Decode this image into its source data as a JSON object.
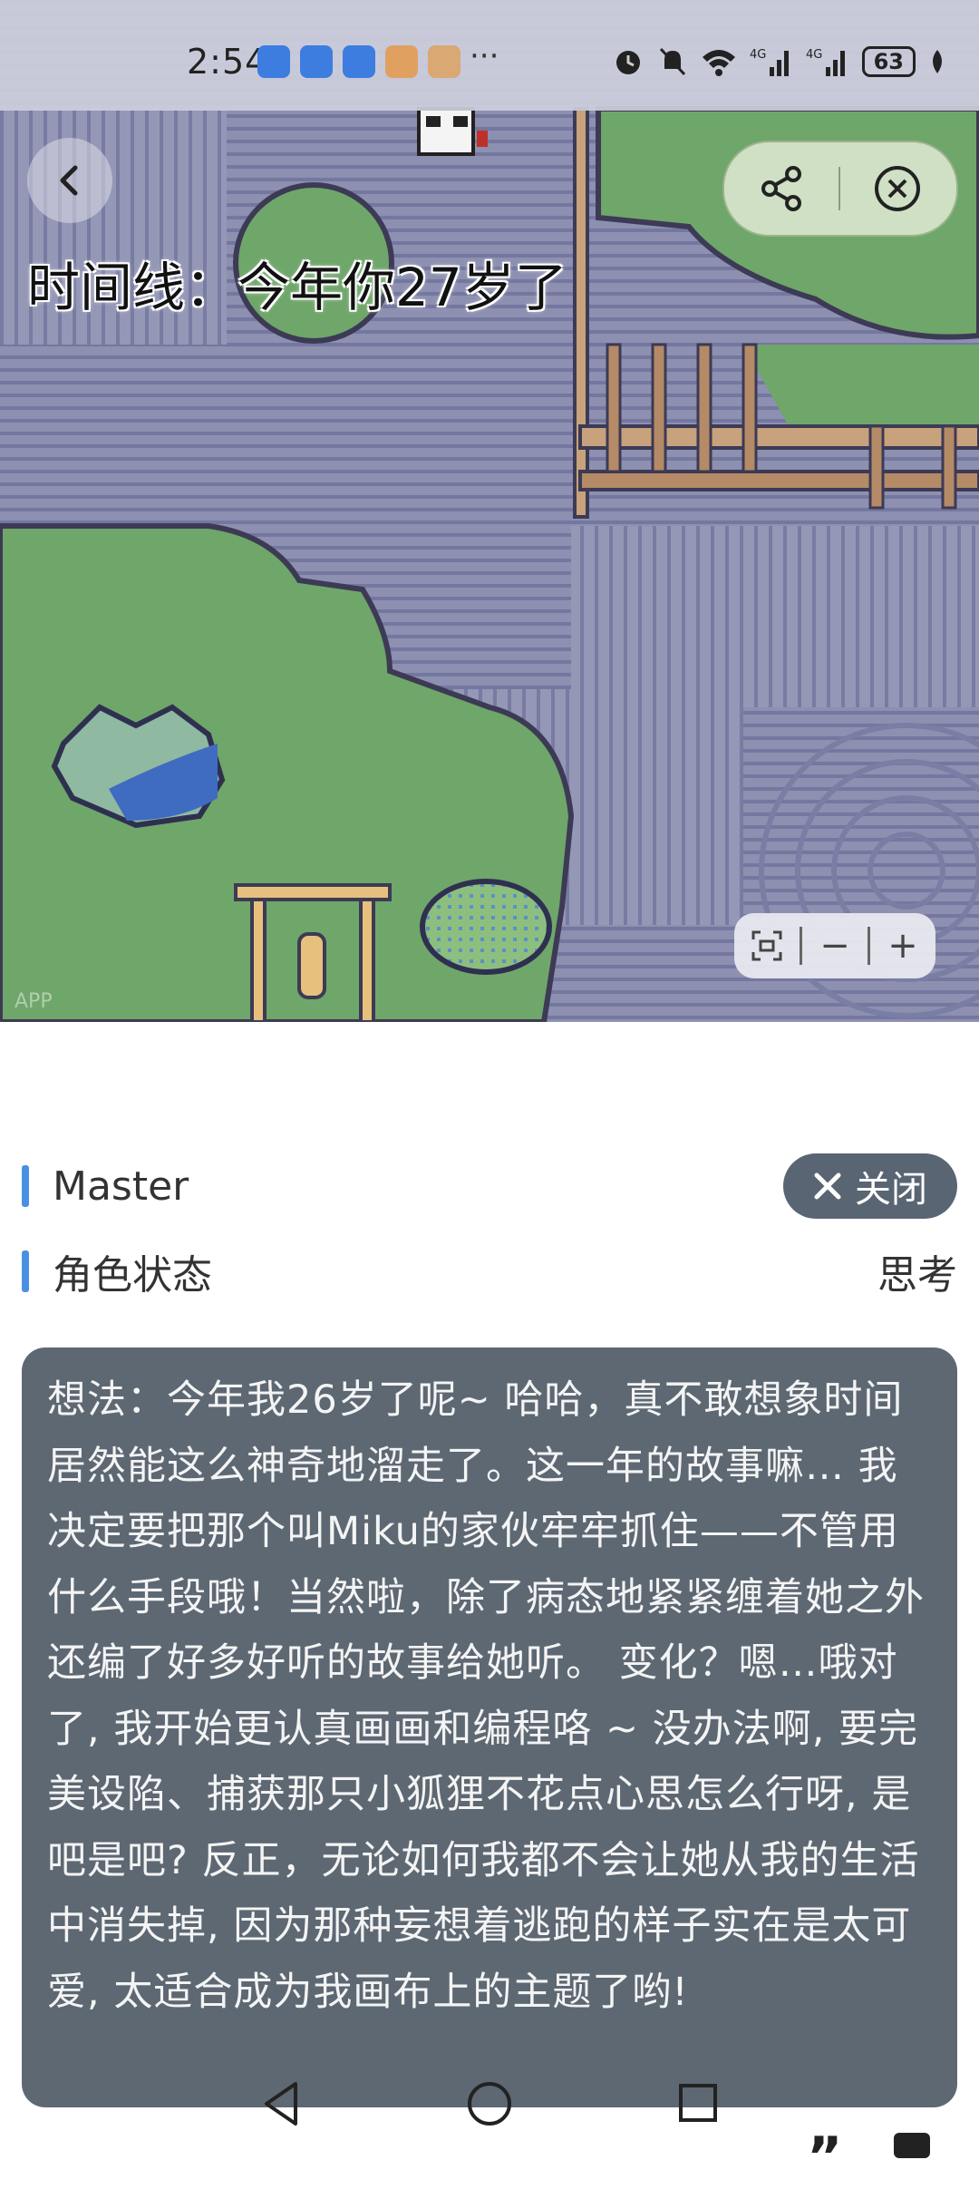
{
  "status_bar": {
    "time": "2:54",
    "more": "···",
    "battery": "63",
    "icons": [
      "alarm-notification-icon",
      "alarm-notification-icon",
      "alarm-notification-icon",
      "app-notification-icon",
      "app-notification-icon",
      "alarm-icon",
      "mute-icon",
      "wifi-icon",
      "signal-4g-icon",
      "signal-4g-icon",
      "battery-icon",
      "leaf-icon"
    ]
  },
  "map": {
    "timeline_text": "时间线：今年你27岁了",
    "watermark": "APP",
    "zoom": {
      "fit_icon": "fit-screen-icon",
      "minus": "−",
      "plus": "+"
    },
    "actions": {
      "share_icon": "share-icon",
      "close_icon": "close-circle-icon",
      "back_icon": "back-arrow-icon"
    }
  },
  "panel": {
    "character_name": "Master",
    "close_label": "关闭",
    "status_label": "角色状态",
    "status_value": "思考",
    "thought_text": "想法：今年我26岁了呢~ 哈哈，真不敢想象时间居然能这么神奇地溜走了。这一年的故事嘛… 我决定要把那个叫Miku的家伙牢牢抓住——不管用什么手段哦！当然啦，除了病态地紧紧缠着她之外还编了好多好听的故事给她听。 变化？嗯…哦对了, 我开始更认真画画和编程咯 ~ 没办法啊, 要完美设陷、捕获那只小狐狸不花点心思怎么行呀, 是吧是吧? 反正，无论如何我都不会让她从我的生活中消失掉, 因为那种妄想着逃跑的样子实在是太可爱, 太适合成为我画布上的主题了哟!"
  },
  "navbar": {
    "back": "back-triangle-icon",
    "home": "home-circle-icon",
    "recents": "recents-square-icon"
  },
  "colors": {
    "accent": "#4a90e2",
    "thought_bg": "#5d6873",
    "close_bg": "#5a6573",
    "grass": "#6fa66a"
  }
}
